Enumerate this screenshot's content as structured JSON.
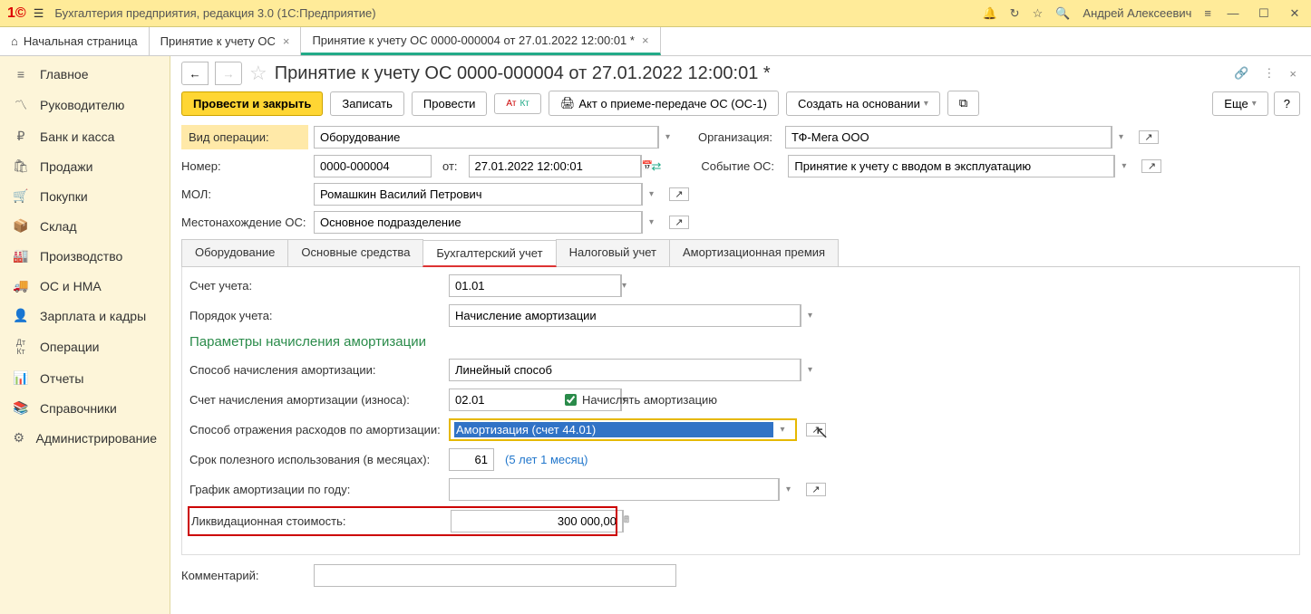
{
  "titlebar": {
    "app_title": "Бухгалтерия предприятия, редакция 3.0  (1С:Предприятие)",
    "user": "Андрей Алексеевич"
  },
  "topTabs": {
    "home": "Начальная страница",
    "t1": "Принятие к учету ОС",
    "t2": "Принятие к учету ОС 0000-000004 от 27.01.2022 12:00:01 *"
  },
  "sidebar": [
    {
      "icon": "≡",
      "label": "Главное"
    },
    {
      "icon": "📈",
      "label": "Руководителю"
    },
    {
      "icon": "₽",
      "label": "Банк и касса"
    },
    {
      "icon": "🛍",
      "label": "Продажи"
    },
    {
      "icon": "🛒",
      "label": "Покупки"
    },
    {
      "icon": "📦",
      "label": "Склад"
    },
    {
      "icon": "🏭",
      "label": "Производство"
    },
    {
      "icon": "🚚",
      "label": "ОС и НМА"
    },
    {
      "icon": "👤",
      "label": "Зарплата и кадры"
    },
    {
      "icon": "Дт",
      "label": "Операции"
    },
    {
      "icon": "📊",
      "label": "Отчеты"
    },
    {
      "icon": "📚",
      "label": "Справочники"
    },
    {
      "icon": "⚙",
      "label": "Администрирование"
    }
  ],
  "doc": {
    "title": "Принятие к учету ОС 0000-000004 от 27.01.2022 12:00:01 *"
  },
  "toolbar": {
    "post_close": "Провести и закрыть",
    "save": "Записать",
    "post": "Провести",
    "print_os1": "Акт о приеме-передаче ОС (ОС-1)",
    "create_based": "Создать на основании",
    "more": "Еще",
    "help": "?"
  },
  "fields": {
    "vid_label": "Вид операции:",
    "vid_value": "Оборудование",
    "org_label": "Организация:",
    "org_value": "ТФ-Мега ООО",
    "num_label": "Номер:",
    "num_value": "0000-000004",
    "ot_label": "от:",
    "date_value": "27.01.2022 12:00:01",
    "event_label": "Событие ОС:",
    "event_value": "Принятие к учету с вводом в эксплуатацию",
    "mol_label": "МОЛ:",
    "mol_value": "Ромашкин Василий Петрович",
    "loc_label": "Местонахождение ОС:",
    "loc_value": "Основное подразделение"
  },
  "innerTabs": {
    "t1": "Оборудование",
    "t2": "Основные средства",
    "t3": "Бухгалтерский учет",
    "t4": "Налоговый учет",
    "t5": "Амортизационная премия"
  },
  "acct": {
    "schet_label": "Счет учета:",
    "schet_value": "01.01",
    "poryadok_label": "Порядок учета:",
    "poryadok_value": "Начисление амортизации",
    "section": "Параметры начисления амортизации",
    "sposob_label": "Способ начисления амортизации:",
    "sposob_value": "Линейный способ",
    "schet_amort_label": "Счет начисления амортизации (износа):",
    "schet_amort_value": "02.01",
    "chk_label": "Начислять амортизацию",
    "rashod_label": "Способ отражения расходов по амортизации:",
    "rashod_value": "Амортизация (счет 44.01)",
    "srok_label": "Срок полезного использования (в месяцах):",
    "srok_value": "61",
    "srok_hint": "(5 лет 1 месяц)",
    "grafik_label": "График амортизации по году:",
    "grafik_value": "",
    "likv_label": "Ликвидационная стоимость:",
    "likv_value": "300 000,00"
  },
  "comment_label": "Комментарий:"
}
